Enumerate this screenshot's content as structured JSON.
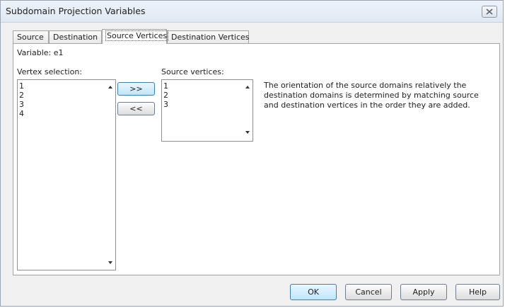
{
  "window": {
    "title": "Subdomain Projection Variables",
    "close_icon": "close-icon"
  },
  "tabs": [
    {
      "label": "Source",
      "active": false
    },
    {
      "label": "Destination",
      "active": false
    },
    {
      "label": "Source Vertices",
      "active": true
    },
    {
      "label": "Destination Vertices",
      "active": false
    }
  ],
  "panel": {
    "variable_label": "Variable: e1",
    "vertex_selection_label": "Vertex selection:",
    "vertex_selection_items": [
      "1",
      "2",
      "3",
      "4"
    ],
    "source_vertices_label": "Source vertices:",
    "source_vertices_items": [
      "1",
      "2",
      "3"
    ],
    "add_button": ">>",
    "remove_button": "<<",
    "note": "The orientation of the source domains relatively the destination domains is determined by matching source and destination vertices in the order they are added."
  },
  "footer": {
    "ok": "OK",
    "cancel": "Cancel",
    "apply": "Apply",
    "help": "Help"
  }
}
